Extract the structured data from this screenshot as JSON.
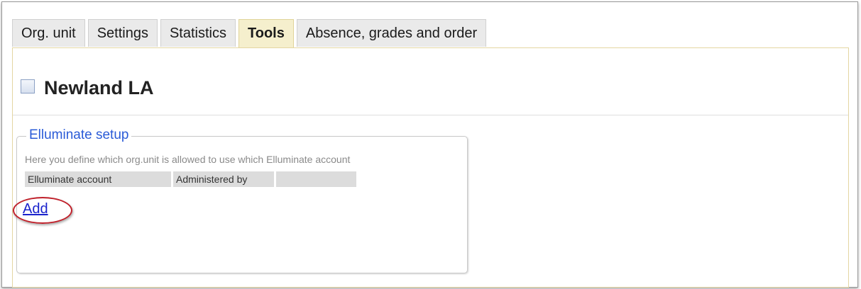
{
  "tabs": [
    {
      "label": "Org. unit",
      "active": false
    },
    {
      "label": "Settings",
      "active": false
    },
    {
      "label": "Statistics",
      "active": false
    },
    {
      "label": "Tools",
      "active": true
    },
    {
      "label": "Absence, grades and order",
      "active": false
    }
  ],
  "org": {
    "title": "Newland LA",
    "icon": "org-unit-icon"
  },
  "elluminate": {
    "legend": "Elluminate setup",
    "description": "Here you define which org.unit is allowed to use which Elluminate account",
    "columns": [
      "Elluminate account",
      "Administered by",
      ""
    ],
    "add_label": "Add"
  },
  "colors": {
    "active_tab": "#f5efcd",
    "legend_text": "#2a5bd7",
    "link": "#1a22cc",
    "highlight_ring": "#c0202a"
  }
}
